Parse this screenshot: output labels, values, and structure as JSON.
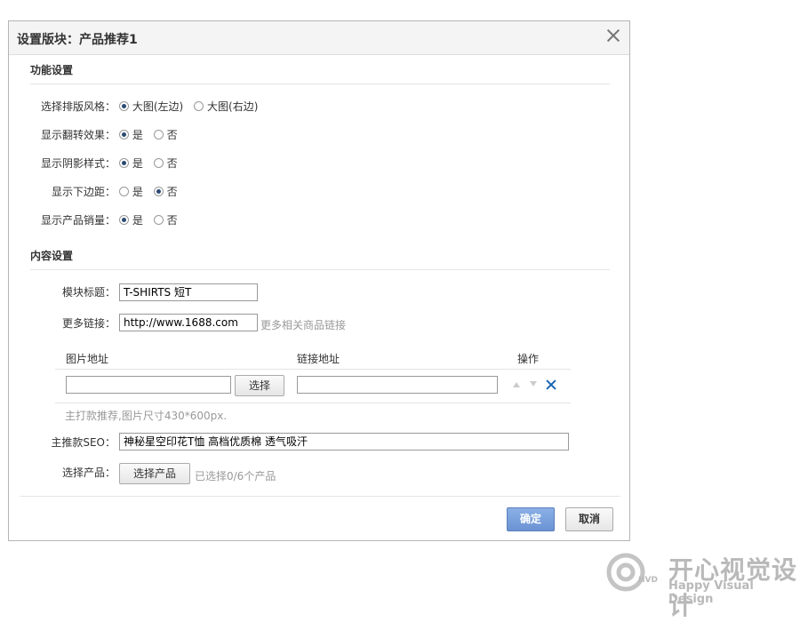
{
  "dialog": {
    "title": "设置版块：产品推荐1"
  },
  "function_settings": {
    "heading": "功能设置",
    "rows": [
      {
        "label": "选择排版风格：",
        "options": [
          "大图(左边)",
          "大图(右边)"
        ],
        "selected": 0
      },
      {
        "label": "显示翻转效果：",
        "options": [
          "是",
          "否"
        ],
        "selected": 0
      },
      {
        "label": "显示阴影样式：",
        "options": [
          "是",
          "否"
        ],
        "selected": 0
      },
      {
        "label": "显示下边距：",
        "options": [
          "是",
          "否"
        ],
        "selected": 1
      },
      {
        "label": "显示产品销量：",
        "options": [
          "是",
          "否"
        ],
        "selected": 0
      }
    ]
  },
  "content_settings": {
    "heading": "内容设置",
    "module_title": {
      "label": "模块标题：",
      "value": "T-SHIRTS 短T"
    },
    "more_link": {
      "label": "更多链接：",
      "value": "http://www.1688.com",
      "hint": "更多相关商品链接"
    },
    "table": {
      "headers": [
        "图片地址",
        "链接地址",
        "操作"
      ],
      "image_url": "",
      "choose_label": "选择",
      "link_url": ""
    },
    "note": "主打款推荐,图片尺寸430*600px.",
    "seo": {
      "label": "主推款SEO：",
      "value": "神秘星空印花T恤 高档优质棉 透气吸汗"
    },
    "product": {
      "label": "选择产品：",
      "button": "选择产品",
      "status": "已选择0/6个产品"
    }
  },
  "footer": {
    "confirm": "确定",
    "cancel": "取消"
  },
  "watermark": {
    "cn": "开心视觉设计",
    "en": "Happy Visual Design",
    "abbr": "HVD"
  },
  "colors": {
    "primary_button": "#7aa2df",
    "delete_icon": "#1a66b3",
    "radio_dot": "#2b4a72"
  }
}
